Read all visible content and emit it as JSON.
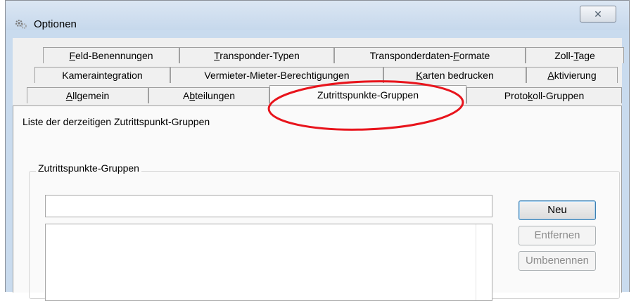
{
  "window": {
    "title": "Optionen",
    "close_glyph": "✕"
  },
  "tabs": {
    "row1": [
      {
        "pre": "",
        "key": "F",
        "post": "eld-Benennungen"
      },
      {
        "pre": "",
        "key": "T",
        "post": "ransponder-Typen"
      },
      {
        "pre": "Transponderdaten-",
        "key": "F",
        "post": "ormate"
      },
      {
        "pre": "Zoll-",
        "key": "T",
        "post": "age"
      }
    ],
    "row2": [
      {
        "pre": "Kameraintegration",
        "key": "",
        "post": ""
      },
      {
        "pre": "Vermieter-Mieter-Berechtigungen",
        "key": "",
        "post": ""
      },
      {
        "pre": "",
        "key": "K",
        "post": "arten bedrucken"
      },
      {
        "pre": "",
        "key": "A",
        "post": "ktivierung"
      }
    ],
    "row3": [
      {
        "pre": "",
        "key": "A",
        "post": "llgemein"
      },
      {
        "pre": "A",
        "key": "b",
        "post": "teilungen"
      },
      {
        "pre": "Zutrittspunkte-Gruppen",
        "key": "",
        "post": ""
      },
      {
        "pre": "Proto",
        "key": "k",
        "post": "oll-Gruppen"
      }
    ]
  },
  "page": {
    "description": "Liste der derzeitigen Zutrittspunkt-Gruppen",
    "group_title": "Zutrittspunkte-Gruppen",
    "name_input_value": "",
    "list_items": []
  },
  "buttons": {
    "new": "Neu",
    "remove": "Entfernen",
    "rename": "Umbenennen"
  },
  "annotation_color": "#e8141c"
}
